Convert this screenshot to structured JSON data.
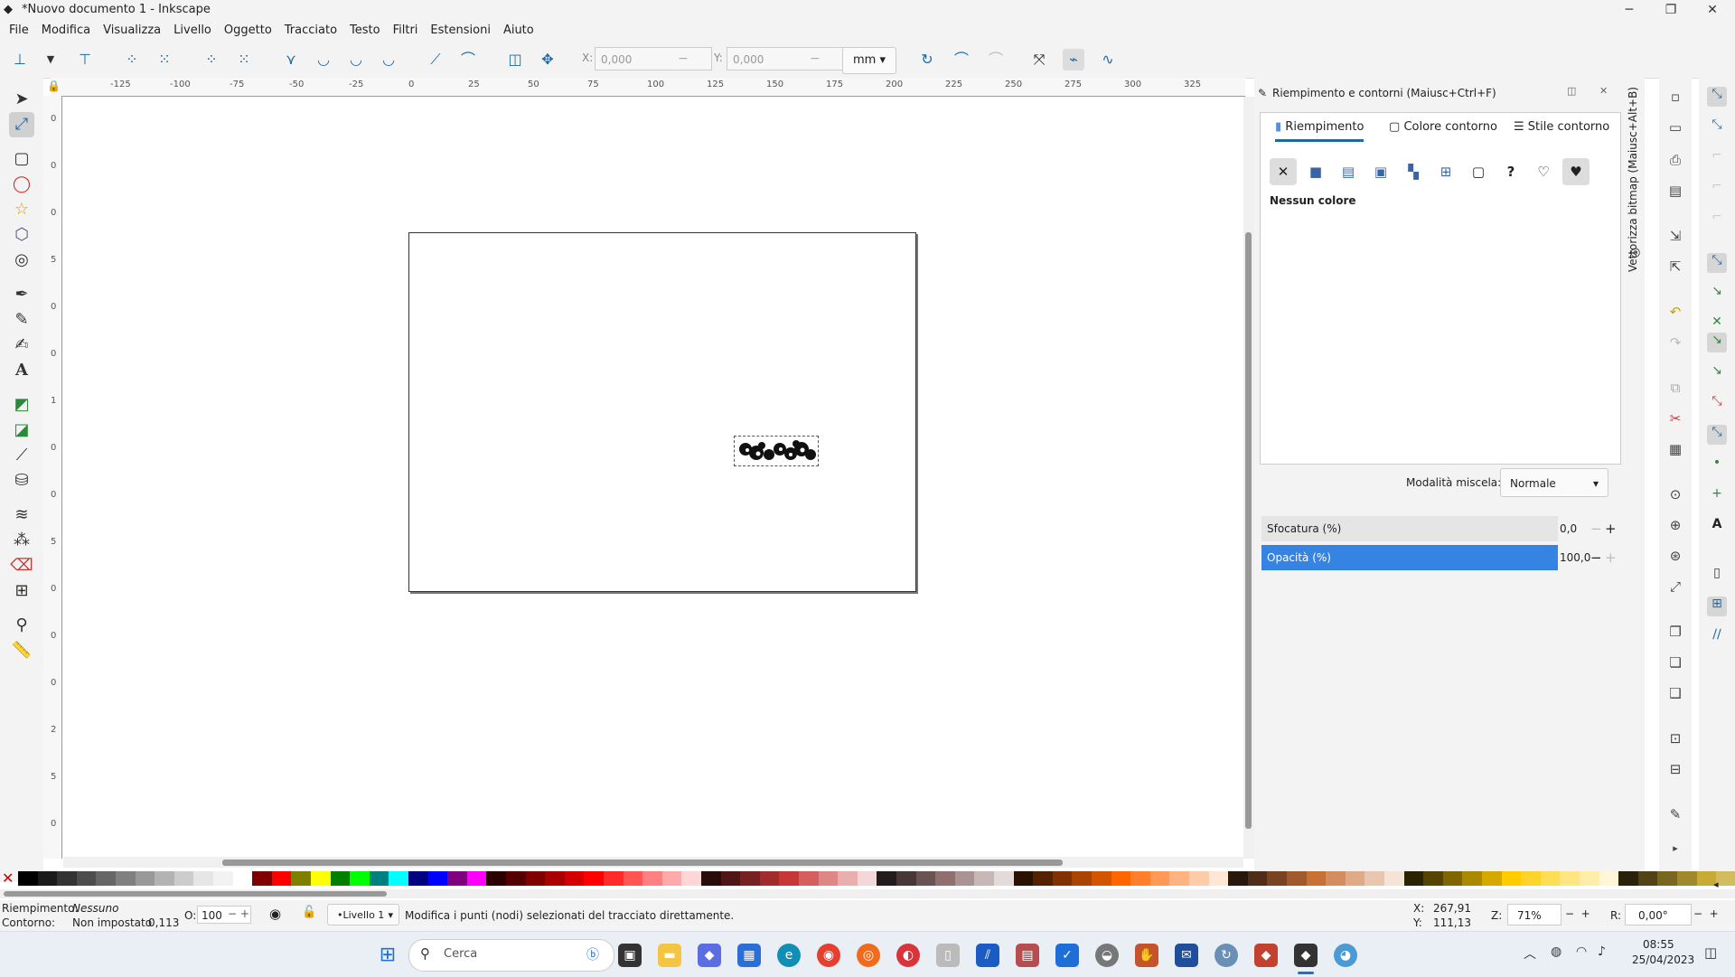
{
  "window": {
    "title": "*Nuovo documento 1 - Inkscape",
    "minimize": "─",
    "maximize": "❐",
    "close": "✕"
  },
  "menu": [
    "File",
    "Modifica",
    "Visualizza",
    "Livello",
    "Oggetto",
    "Tracciato",
    "Testo",
    "Filtri",
    "Estensioni",
    "Aiuto"
  ],
  "toolbar": {
    "x_label": "X:",
    "x_value": "0,000",
    "y_label": "Y:",
    "y_value": "0,000",
    "unit": "mm"
  },
  "ruler_top": [
    "-125",
    "-100",
    "-75",
    "-50",
    "-25",
    "0",
    "25",
    "50",
    "75",
    "100",
    "125",
    "150",
    "175",
    "200",
    "225",
    "250",
    "275",
    "300",
    "325"
  ],
  "ruler_left": [
    "0",
    "0",
    "0",
    "5",
    "0",
    "0",
    "1",
    "0",
    "0",
    "5",
    "0",
    "0",
    "0",
    "2",
    "5",
    "0"
  ],
  "dialog": {
    "title": "Riempimento e contorni (Maiusc+Ctrl+F)",
    "tabs": [
      "Riempimento",
      "Colore contorno",
      "Stile contorno"
    ],
    "fill_status": "Nessun colore",
    "blend_label": "Modalità miscela:",
    "blend_value": "Normale",
    "blur_label": "Sfocatura (%)",
    "blur_value": "0,0",
    "opacity_label": "Opacità (%)",
    "opacity_value": "100,0"
  },
  "side_panel": {
    "label": "Vettorizza bitmap (Maiusc+Alt+B)"
  },
  "status": {
    "fill_label": "Riempimento:",
    "fill_value": "Nessuno",
    "stroke_label": "Contorno:",
    "stroke_value": "Non impostato",
    "stroke_width": "0,113",
    "opacity_label": "O:",
    "opacity_value": "100",
    "layer": "•Livello 1",
    "message": "Modifica i punti (nodi) selezionati del tracciato direttamente.",
    "x_label": "X:",
    "x_value": "267,91",
    "y_label": "Y:",
    "y_value": "111,13",
    "zoom_label": "Z:",
    "zoom_value": "71%",
    "rotate_label": "R:",
    "rotate_value": "0,00°"
  },
  "taskbar": {
    "search_placeholder": "Cerca",
    "time": "08:55",
    "date": "25/04/2023"
  },
  "palette": [
    "#000000",
    "#1a1a1a",
    "#333333",
    "#4d4d4d",
    "#666666",
    "#808080",
    "#999999",
    "#b3b3b3",
    "#cccccc",
    "#e6e6e6",
    "#f2f2f2",
    "#ffffff",
    "#800000",
    "#ff0000",
    "#808000",
    "#ffff00",
    "#008000",
    "#00ff00",
    "#008080",
    "#00ffff",
    "#000080",
    "#0000ff",
    "#800080",
    "#ff00ff",
    "#2b0000",
    "#550000",
    "#800000",
    "#aa0000",
    "#d40000",
    "#ff0000",
    "#ff2a2a",
    "#ff5555",
    "#ff8080",
    "#ffaaaa",
    "#ffd5d5",
    "#280b0b",
    "#501616",
    "#782121",
    "#a02c2c",
    "#c83737",
    "#d35f5f",
    "#de8787",
    "#e9afaf",
    "#f4d7d7",
    "#241c1c",
    "#483737",
    "#6c5353",
    "#916f6f",
    "#ac9393",
    "#c8b7b7",
    "#e3dbdb",
    "#2b1100",
    "#552200",
    "#803300",
    "#aa4400",
    "#d45500",
    "#ff6600",
    "#ff7f2a",
    "#ff9955",
    "#ffb380",
    "#ffccaa",
    "#ffe6d5",
    "#28170b",
    "#502d16",
    "#784421",
    "#a05a2c",
    "#c87137",
    "#d38d5f",
    "#deaa87",
    "#e9c6af",
    "#f4e3d7",
    "#2b2200",
    "#554400",
    "#806600",
    "#aa8800",
    "#d4aa00",
    "#ffcc00",
    "#ffd42a",
    "#ffdd55",
    "#ffe680",
    "#ffeeaa",
    "#fff6d5",
    "#28220b",
    "#504416",
    "#786721",
    "#a0892c",
    "#c8ab37",
    "#d3bc5f",
    "#decd87"
  ]
}
